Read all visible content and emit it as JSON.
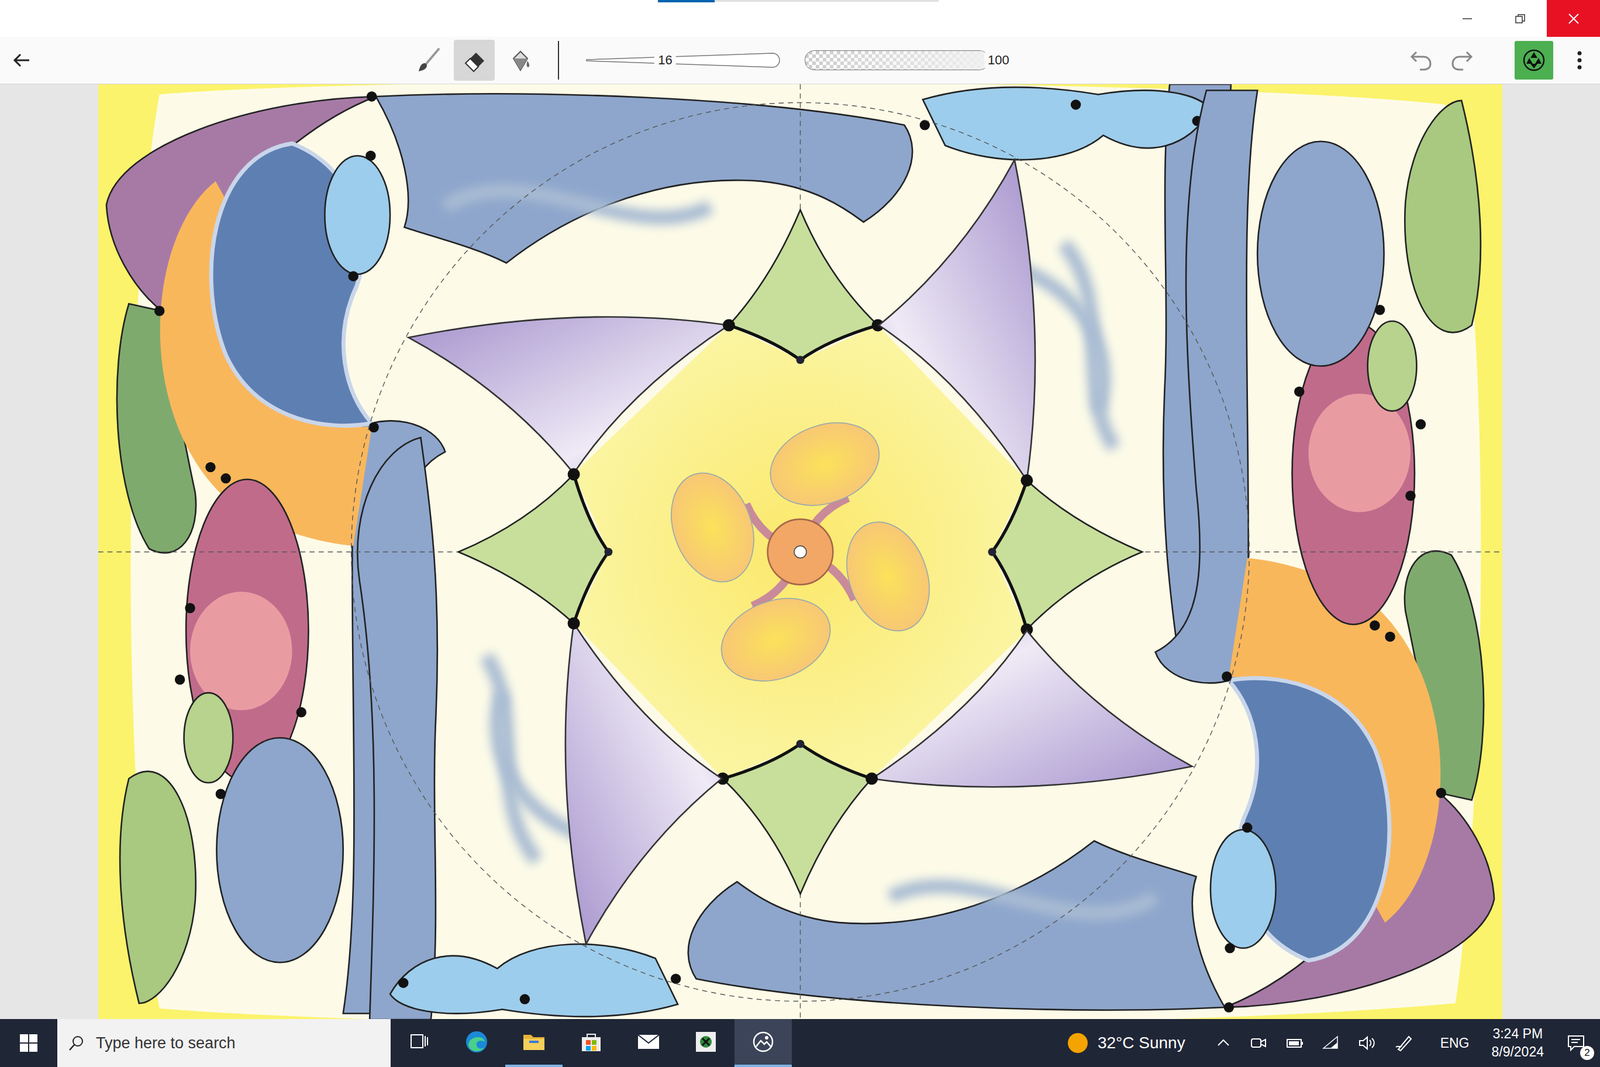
{
  "tools": [
    {
      "kind": "brush",
      "selected": false
    },
    {
      "kind": "eraser",
      "selected": true
    },
    {
      "kind": "fill",
      "selected": false
    }
  ],
  "size": {
    "value": "16",
    "level": 0.4
  },
  "opacity": {
    "value": "100",
    "level": 1.0
  },
  "taskbar": {
    "search_placeholder": "Type here to search",
    "apps": [
      {
        "kind": "task-view",
        "active": false
      },
      {
        "kind": "edge",
        "active": false
      },
      {
        "kind": "explorer",
        "active": true
      },
      {
        "kind": "store",
        "active": false
      },
      {
        "kind": "mail",
        "active": false
      },
      {
        "kind": "xbox",
        "active": false
      },
      {
        "kind": "photos",
        "active": true
      }
    ],
    "weather": "32°C Sunny",
    "language": "ENG",
    "time": "3:24 PM",
    "date": "8/9/2024",
    "notifications": "2"
  }
}
